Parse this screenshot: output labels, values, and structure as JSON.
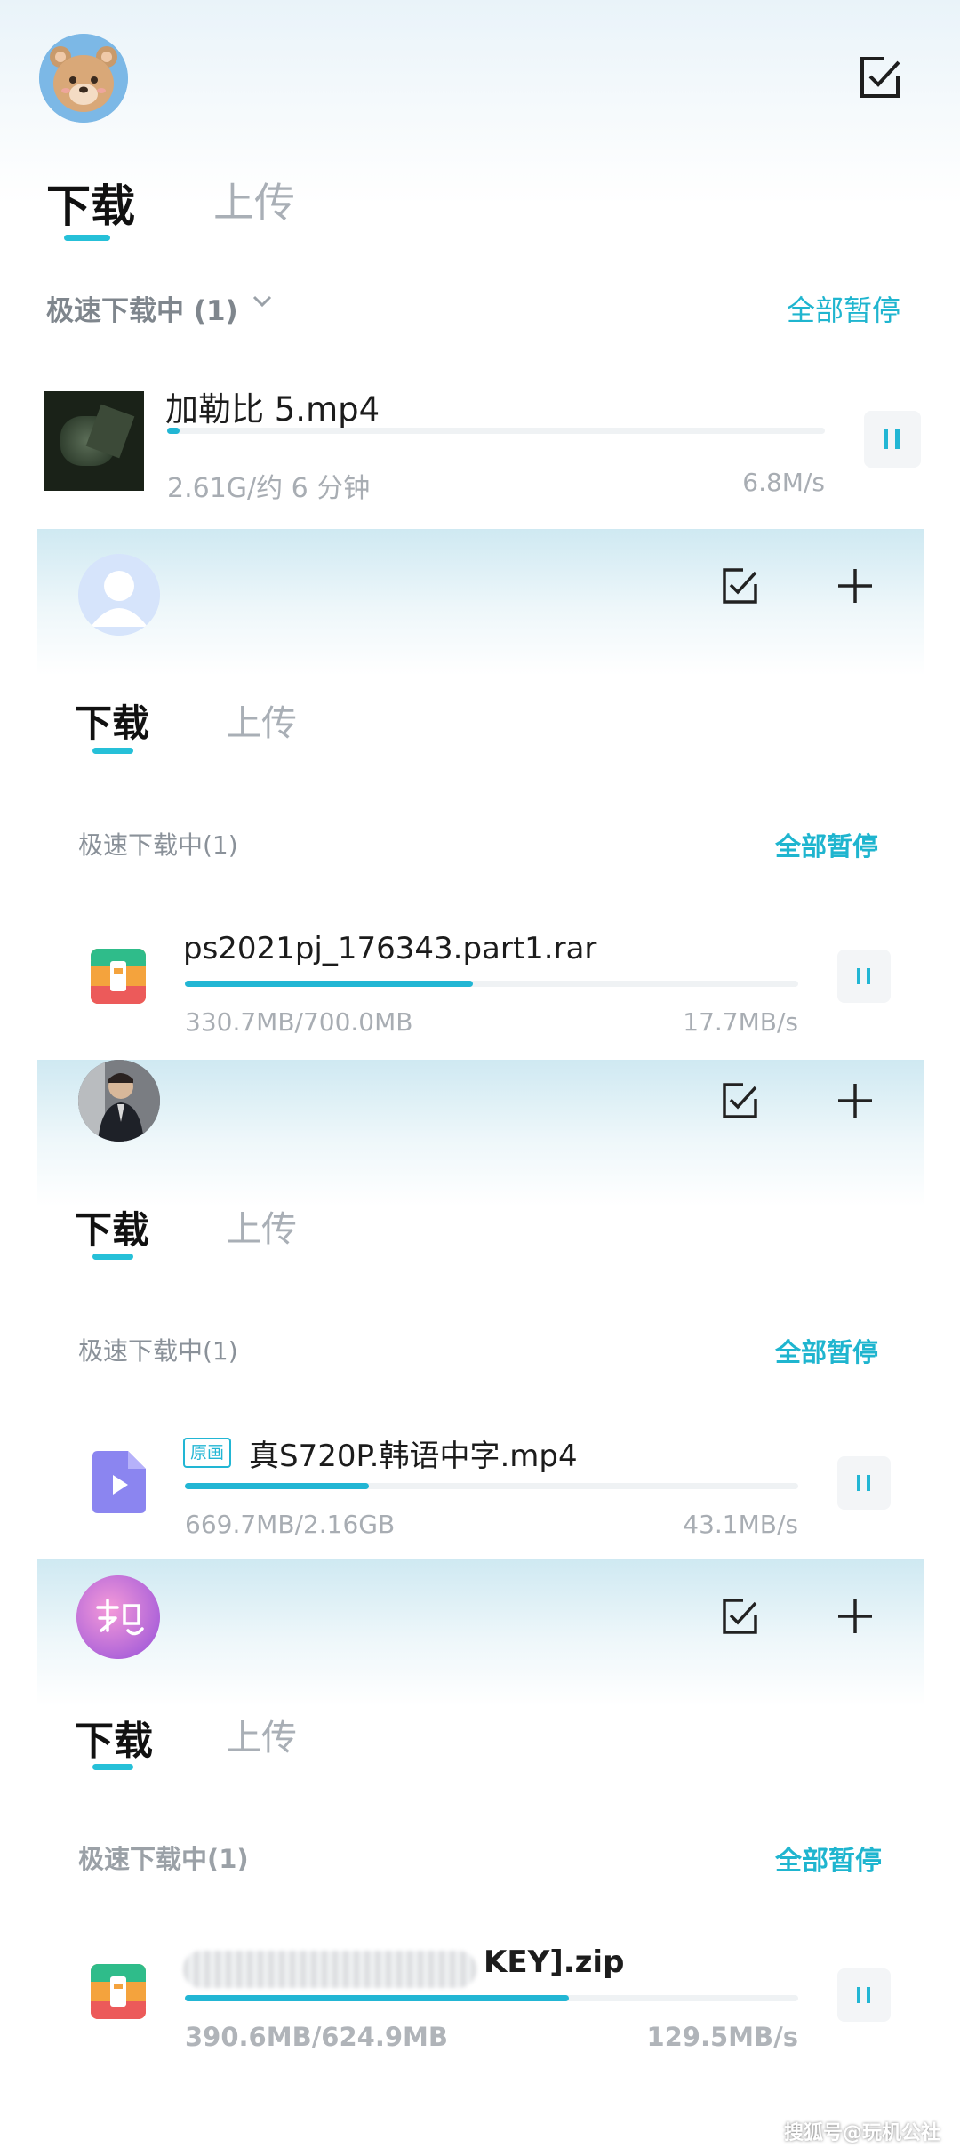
{
  "accent_color": "#22b6d4",
  "panels": [
    {
      "tabs": {
        "download": "下载",
        "upload": "上传"
      },
      "section_title": "极速下载中 (1)",
      "pause_all": "全部暂停",
      "file": {
        "name": "加勒比 5.mp4",
        "meta": "2.61G/约 6 分钟",
        "speed": "6.8M/s",
        "progress": 0.02,
        "icon": "video-thumbnail"
      }
    },
    {
      "tabs": {
        "download": "下载",
        "upload": "上传"
      },
      "section_title": "极速下载中(1)",
      "pause_all": "全部暂停",
      "file": {
        "name": "ps2021pj_176343.part1.rar",
        "meta": "330.7MB/700.0MB",
        "speed": "17.7MB/s",
        "progress": 0.47,
        "icon": "archive-icon"
      }
    },
    {
      "tabs": {
        "download": "下载",
        "upload": "上传"
      },
      "section_title": "极速下载中(1)",
      "pause_all": "全部暂停",
      "file": {
        "badge": "原画",
        "name": "真S720P.韩语中字.mp4",
        "meta": "669.7MB/2.16GB",
        "speed": "43.1MB/s",
        "progress": 0.3,
        "icon": "video-file-icon"
      }
    },
    {
      "tabs": {
        "download": "下载",
        "upload": "上传"
      },
      "section_title": "极速下载中(1)",
      "pause_all": "全部暂停",
      "file": {
        "name": "KEY].zip",
        "meta": "390.6MB/624.9MB",
        "speed": "129.5MB/s",
        "progress": 0.62,
        "icon": "archive-icon"
      }
    }
  ],
  "watermark": "搜狐号@玩机公社"
}
